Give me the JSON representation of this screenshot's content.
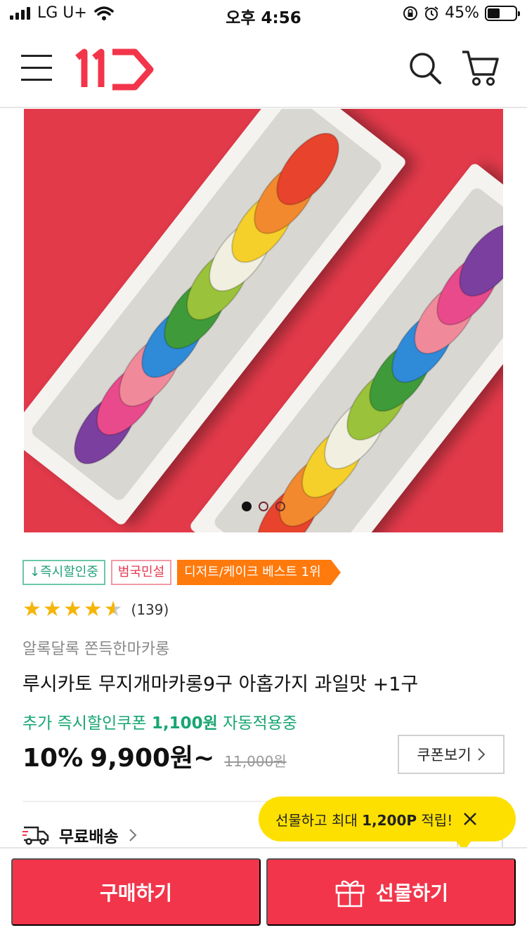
{
  "status_bar": {
    "carrier": "LG U+",
    "time": "오후 4:56",
    "battery_text": "45%",
    "battery_level": 0.45
  },
  "header": {
    "logo_text": "11",
    "menu_icon": "hamburger-menu-icon",
    "search_icon": "search-icon",
    "cart_icon": "cart-icon"
  },
  "gallery": {
    "image_alt": "rainbow macarons on white trays",
    "slide_count": 3,
    "active_slide": 1
  },
  "badges": [
    {
      "label": "↓즉시할인중",
      "style": "green"
    },
    {
      "label": "범국민설",
      "style": "red"
    },
    {
      "label": "디저트/케이크 베스트 1위",
      "style": "orange"
    }
  ],
  "rating": {
    "stars": 4.5,
    "count_text": "(139)"
  },
  "product": {
    "brand": "알록달록 쫀득한마카롱",
    "title": "루시카토 무지개마카롱9구 아홉가지 과일맛 +1구",
    "coupon_prefix": "추가 즉시할인쿠폰",
    "coupon_amount": "1,100원",
    "coupon_suffix": "자동적용중",
    "discount": "10%",
    "price": "9,900원~",
    "original_price": "11,000원",
    "coupon_button": "쿠폰보기"
  },
  "shipping": {
    "label": "무료배송"
  },
  "tooltip": {
    "prefix": "선물하고 최대",
    "points": "1,200P",
    "suffix": "적립!"
  },
  "actions": {
    "buy_label": "구매하기",
    "gift_label": "선물하기"
  },
  "colors": {
    "brand_red": "#f2354a",
    "coupon_green": "#17a672",
    "tooltip_yellow": "#fde000",
    "best_orange": "#ff7a0d",
    "star": "#f5b50a"
  }
}
